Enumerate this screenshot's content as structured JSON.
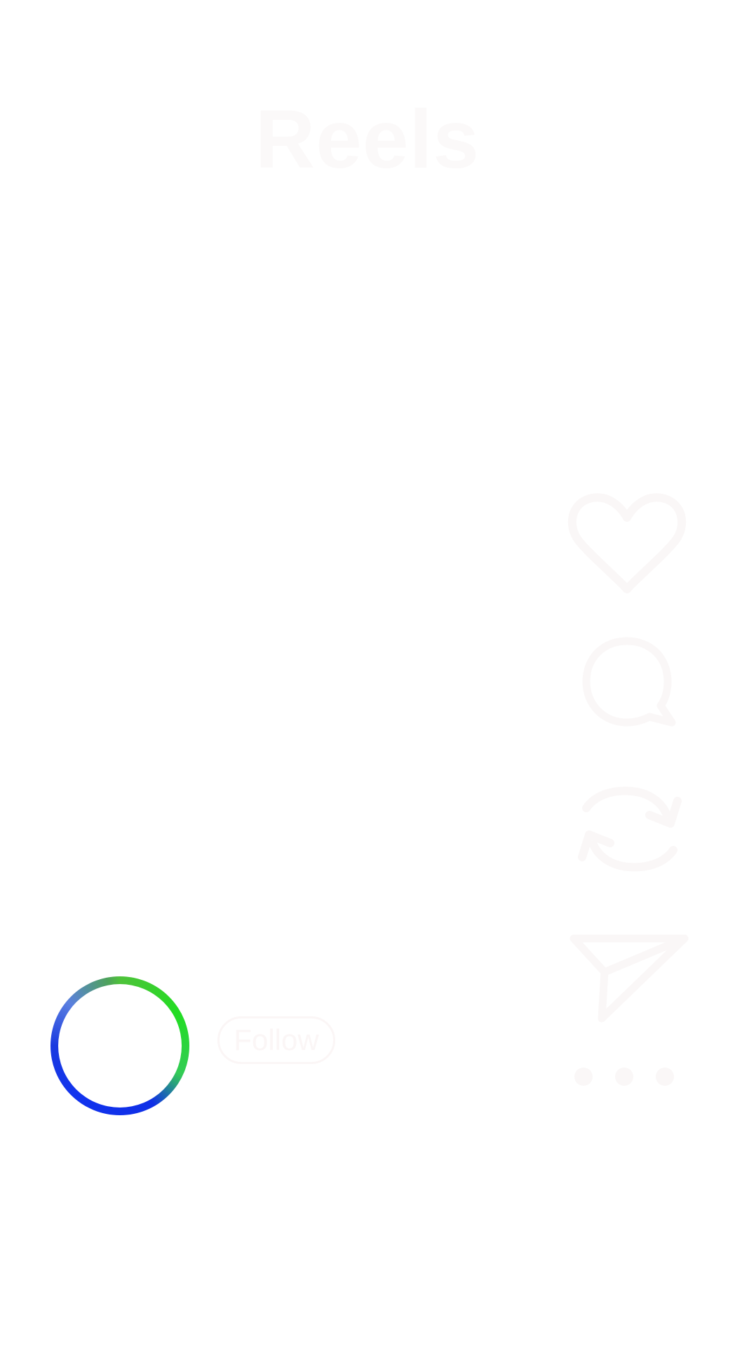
{
  "header": {
    "title": "Reels"
  },
  "actions": {
    "like_icon": "heart-icon",
    "comment_icon": "comment-bubble-icon",
    "remix_icon": "remix-arrows-icon",
    "share_icon": "paper-plane-icon",
    "more_icon": "more-dots-icon"
  },
  "creator": {
    "avatar_icon": "avatar-story-ring",
    "follow_label": "Follow"
  },
  "colors": {
    "overlay_text": "#fbf9f9",
    "ring_green": "#22dd22",
    "ring_blue": "#1133ee",
    "background": "#ffffff"
  }
}
